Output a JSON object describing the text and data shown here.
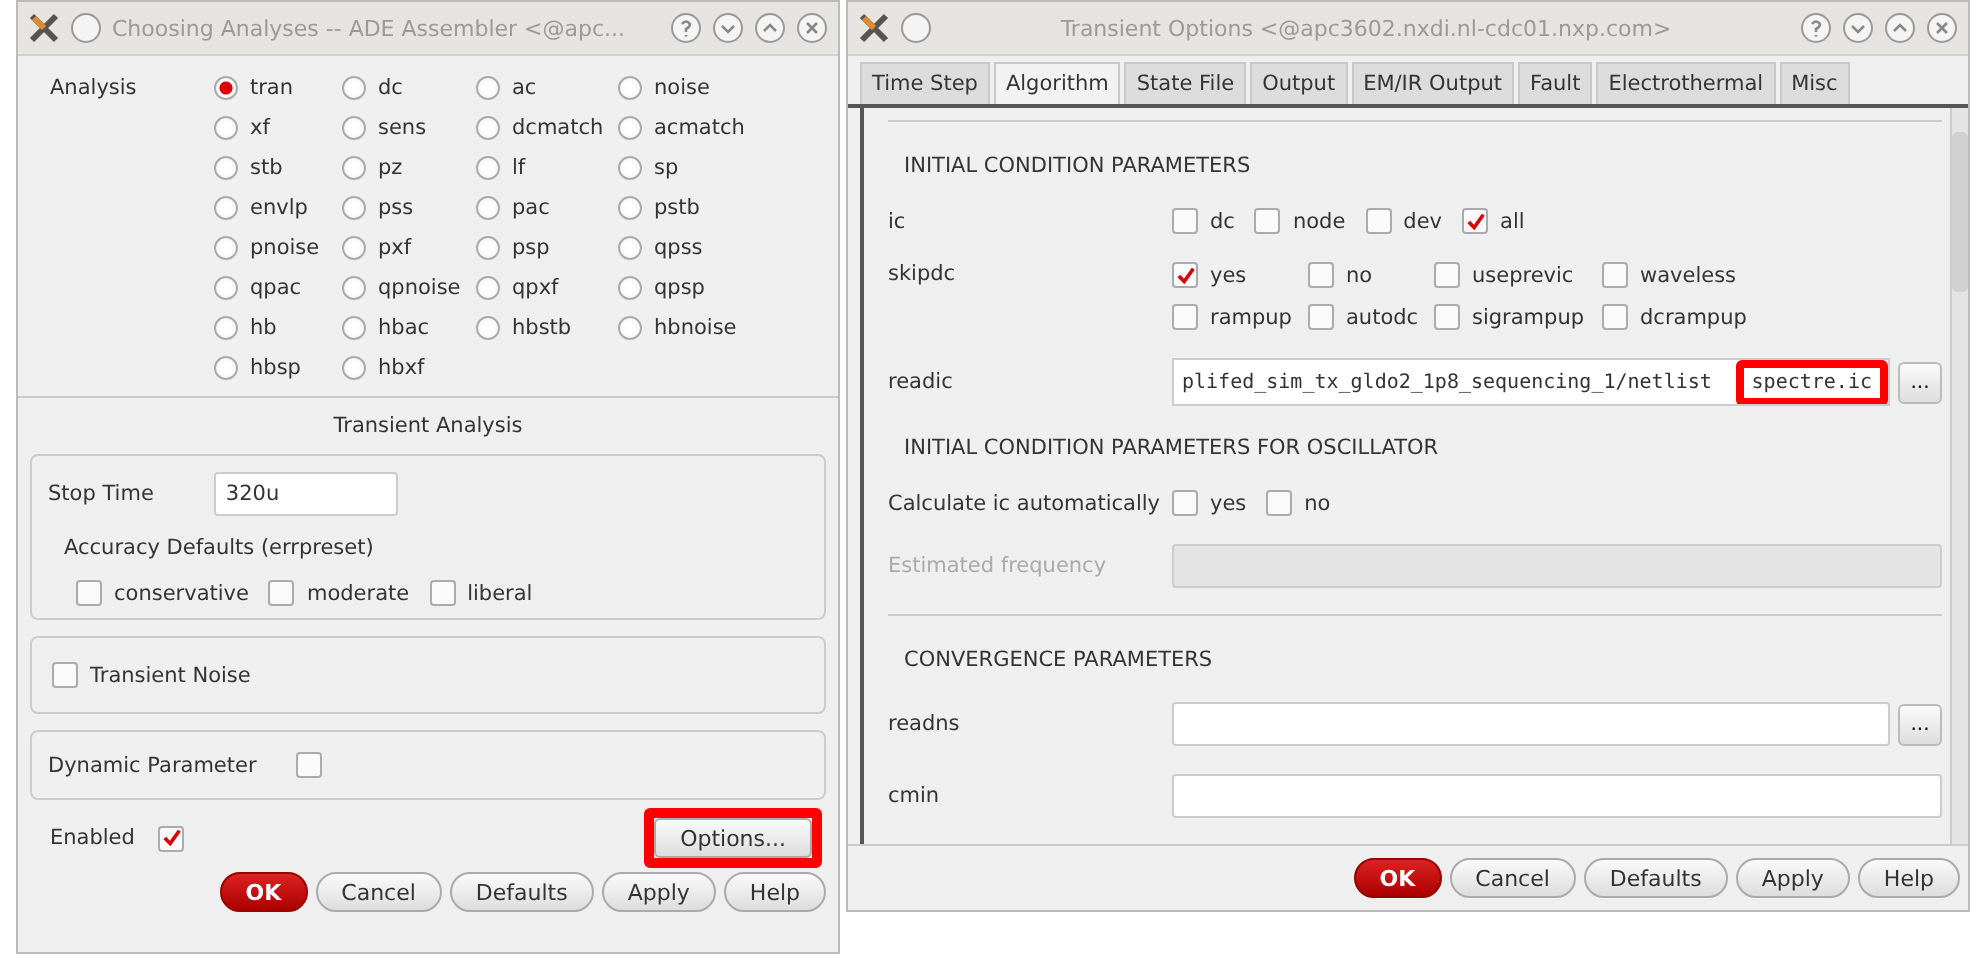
{
  "analysis_window": {
    "title": "Choosing Analyses -- ADE Assembler <@apc...",
    "analysis_label": "Analysis",
    "analyses": [
      {
        "label": "tran",
        "selected": true
      },
      {
        "label": "dc",
        "selected": false
      },
      {
        "label": "ac",
        "selected": false
      },
      {
        "label": "noise",
        "selected": false
      },
      {
        "label": "xf",
        "selected": false
      },
      {
        "label": "sens",
        "selected": false
      },
      {
        "label": "dcmatch",
        "selected": false
      },
      {
        "label": "acmatch",
        "selected": false
      },
      {
        "label": "stb",
        "selected": false
      },
      {
        "label": "pz",
        "selected": false
      },
      {
        "label": "lf",
        "selected": false
      },
      {
        "label": "sp",
        "selected": false
      },
      {
        "label": "envlp",
        "selected": false
      },
      {
        "label": "pss",
        "selected": false
      },
      {
        "label": "pac",
        "selected": false
      },
      {
        "label": "pstb",
        "selected": false
      },
      {
        "label": "pnoise",
        "selected": false
      },
      {
        "label": "pxf",
        "selected": false
      },
      {
        "label": "psp",
        "selected": false
      },
      {
        "label": "qpss",
        "selected": false
      },
      {
        "label": "qpac",
        "selected": false
      },
      {
        "label": "qpnoise",
        "selected": false
      },
      {
        "label": "qpxf",
        "selected": false
      },
      {
        "label": "qpsp",
        "selected": false
      },
      {
        "label": "hb",
        "selected": false
      },
      {
        "label": "hbac",
        "selected": false
      },
      {
        "label": "hbstb",
        "selected": false
      },
      {
        "label": "hbnoise",
        "selected": false
      },
      {
        "label": "hbsp",
        "selected": false
      },
      {
        "label": "hbxf",
        "selected": false
      }
    ],
    "section_title": "Transient Analysis",
    "stop_time": {
      "label": "Stop Time",
      "value": "320u"
    },
    "accuracy": {
      "label": "Accuracy Defaults (errpreset)",
      "options": [
        {
          "label": "conservative",
          "checked": false
        },
        {
          "label": "moderate",
          "checked": false
        },
        {
          "label": "liberal",
          "checked": false
        }
      ]
    },
    "transient_noise": {
      "label": "Transient Noise",
      "checked": false
    },
    "dynamic_parameter": {
      "label": "Dynamic Parameter",
      "checked": false
    },
    "enabled": {
      "label": "Enabled",
      "checked": true
    },
    "options_button": {
      "label": "Options...",
      "highlighted": true
    },
    "buttons": [
      {
        "label": "OK",
        "kind": "primary"
      },
      {
        "label": "Cancel",
        "kind": "normal"
      },
      {
        "label": "Defaults",
        "kind": "normal"
      },
      {
        "label": "Apply",
        "kind": "normal"
      },
      {
        "label": "Help",
        "kind": "normal"
      }
    ]
  },
  "options_window": {
    "title": "Transient Options <@apc3602.nxdi.nl-cdc01.nxp.com>",
    "tabs": [
      {
        "label": "Time Step",
        "selected": false
      },
      {
        "label": "Algorithm",
        "selected": true
      },
      {
        "label": "State File",
        "selected": false
      },
      {
        "label": "Output",
        "selected": false
      },
      {
        "label": "EM/IR Output",
        "selected": false
      },
      {
        "label": "Fault",
        "selected": false
      },
      {
        "label": "Electrothermal",
        "selected": false
      },
      {
        "label": "Misc",
        "selected": false
      }
    ],
    "content": [
      {
        "kind": "separator"
      },
      {
        "kind": "heading",
        "text": "INITIAL CONDITION PARAMETERS"
      },
      {
        "kind": "check-row",
        "label": "ic",
        "options": [
          {
            "label": "dc",
            "checked": false
          },
          {
            "label": "node",
            "checked": false
          },
          {
            "label": "dev",
            "checked": false
          },
          {
            "label": "all",
            "checked": true
          }
        ]
      },
      {
        "kind": "check-grid",
        "label": "skipdc",
        "options": [
          {
            "label": "yes",
            "checked": true
          },
          {
            "label": "no",
            "checked": false
          },
          {
            "label": "useprevic",
            "checked": false
          },
          {
            "label": "waveless",
            "checked": false
          },
          {
            "label": "rampup",
            "checked": false
          },
          {
            "label": "autodc",
            "checked": false
          },
          {
            "label": "sigrampup",
            "checked": false
          },
          {
            "label": "dcrampup",
            "checked": false
          }
        ]
      },
      {
        "kind": "file",
        "label": "readic",
        "value": "plifed_sim_tx_gldo2_1p8_sequencing_1/netlist",
        "highlighted_value": "spectre.ic",
        "browse": "..."
      },
      {
        "kind": "heading",
        "text": "INITIAL CONDITION PARAMETERS FOR OSCILLATOR"
      },
      {
        "kind": "check-row",
        "label": "Calculate ic automatically",
        "options": [
          {
            "label": "yes",
            "checked": false
          },
          {
            "label": "no",
            "checked": false
          }
        ]
      },
      {
        "kind": "field",
        "label": "Estimated frequency",
        "disabled": true
      },
      {
        "kind": "separator"
      },
      {
        "kind": "heading",
        "text": "CONVERGENCE PARAMETERS"
      },
      {
        "kind": "file",
        "label": "readns",
        "browse": "..."
      },
      {
        "kind": "field",
        "label": "cmin",
        "disabled": false
      }
    ],
    "buttons": [
      {
        "label": "OK",
        "kind": "primary"
      },
      {
        "label": "Cancel",
        "kind": "normal"
      },
      {
        "label": "Defaults",
        "kind": "normal"
      },
      {
        "label": "Apply",
        "kind": "normal"
      },
      {
        "label": "Help",
        "kind": "normal"
      }
    ]
  }
}
